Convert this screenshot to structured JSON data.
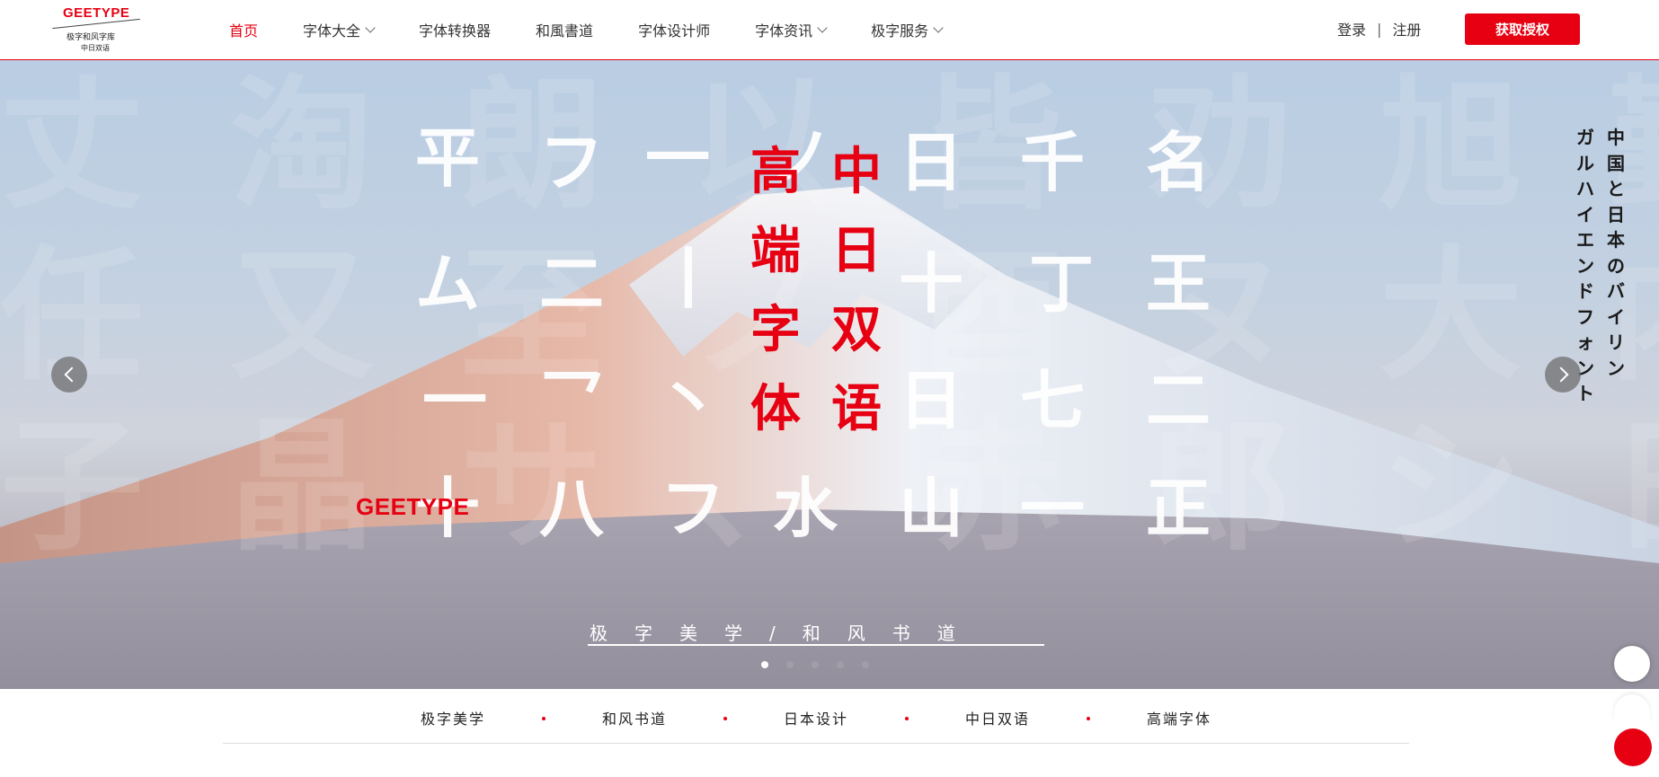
{
  "brand": {
    "name": "GEETYPE",
    "mark": "®",
    "sub1": "极字和风字库",
    "sub2": "中日双语",
    "accent": "#e60012"
  },
  "nav": [
    {
      "label": "首页",
      "active": true,
      "dropdown": false
    },
    {
      "label": "字体大全",
      "dropdown": true
    },
    {
      "label": "字体转换器",
      "dropdown": false
    },
    {
      "label": "和風書道",
      "dropdown": false
    },
    {
      "label": "字体设计师",
      "dropdown": false
    },
    {
      "label": "字体资讯",
      "dropdown": true
    },
    {
      "label": "极字服务",
      "dropdown": true
    }
  ],
  "auth": {
    "login": "登录",
    "sep": "|",
    "register": "注册"
  },
  "cta": {
    "label": "获取授权"
  },
  "hero": {
    "watermark_rows": [
      "丈 淘 朗 以 皆 劝 旭 勤 珍 炎 丸",
      "任 又 至 ノ 酉 ヌ 大 内 至 冬 匠",
      "子 晶 サ 、 赤 郎 シ 日 七 竜 力"
    ],
    "bigchars": [
      "平",
      "フ",
      "一",
      "ノ",
      "日",
      "千",
      "名",
      "ム",
      "二",
      "丨",
      "十",
      "丁",
      "王",
      "一",
      "乛",
      "丶",
      "日",
      "七",
      "二",
      "十",
      "八",
      "フ",
      "水",
      "山",
      "一",
      "正"
    ],
    "red_col1": [
      "高",
      "端",
      "字",
      "体"
    ],
    "red_col2": [
      "中",
      "日",
      "双",
      "语"
    ],
    "red_logo": "GEETYPE",
    "jp_col1": [
      "中",
      "国",
      "と",
      "日",
      "本",
      "の",
      "バ",
      "イ",
      "リ",
      "ン"
    ],
    "jp_col2": [
      "ガ",
      "ル",
      "ハ",
      "イ",
      "エ",
      "ン",
      "ド",
      "フ",
      "ォ",
      "ン",
      "ト"
    ],
    "slogan": "极字美学/和风书道",
    "slides": 5,
    "active_slide": 1
  },
  "tags": [
    "极字美学",
    "和风书道",
    "日本设计",
    "中日双语",
    "高端字体"
  ]
}
